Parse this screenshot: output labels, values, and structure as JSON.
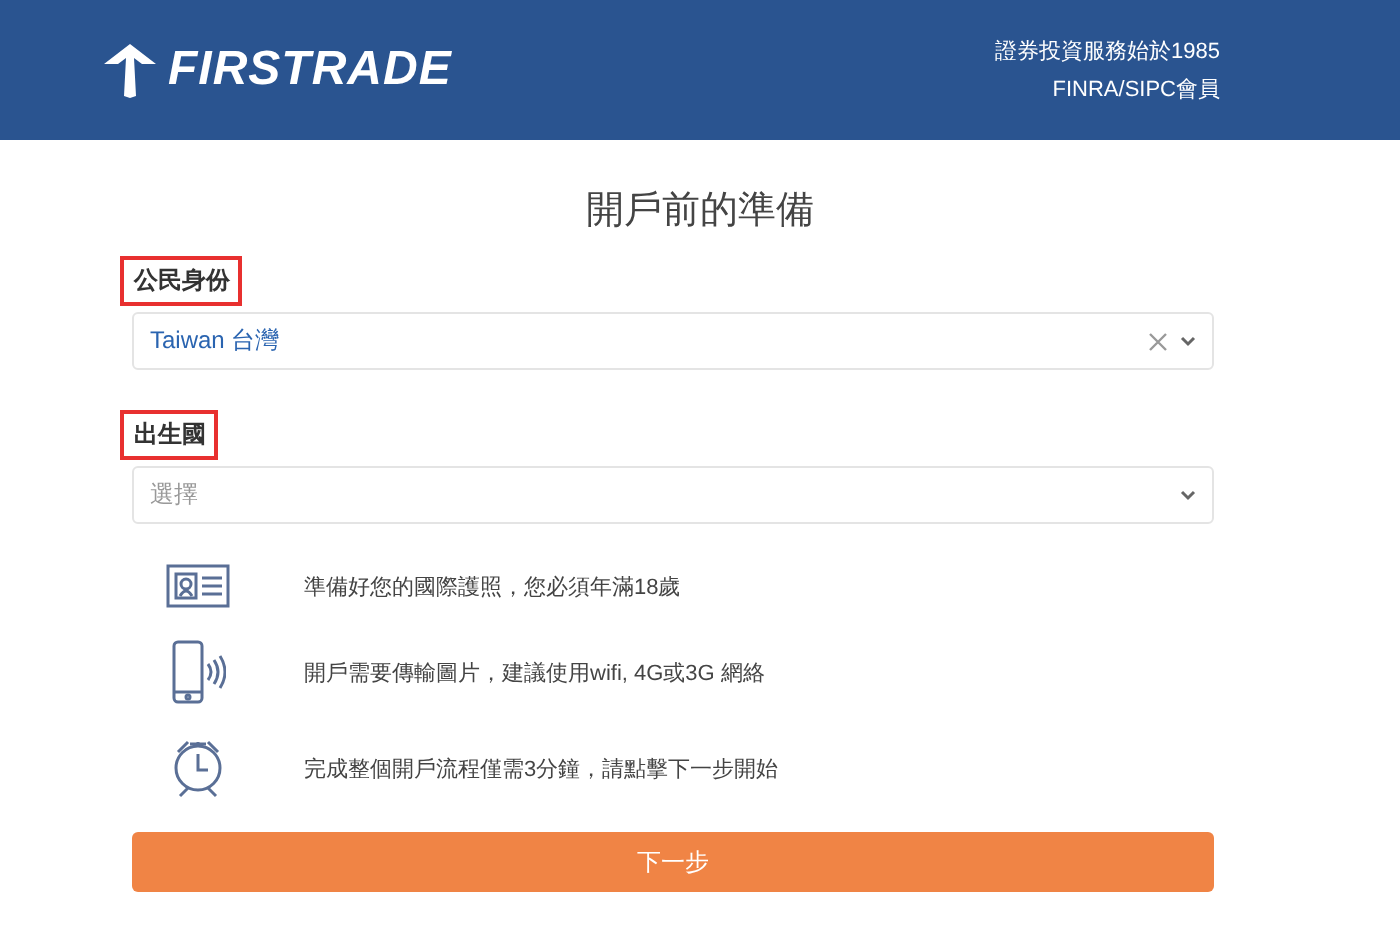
{
  "header": {
    "logo": "FIRSTRADE",
    "tagline": "證券投資服務始於1985",
    "membership": "FINRA/SIPC會員"
  },
  "title": "開戶前的準備",
  "fields": [
    {
      "label": "公民身份",
      "highlighted": true,
      "value": "Taiwan 台灣",
      "clearable": true
    },
    {
      "label": "出生國",
      "highlighted": true,
      "placeholder": "選擇",
      "clearable": false
    }
  ],
  "checklist": [
    {
      "kind": "id",
      "text": "準備好您的國際護照，您必須年滿18歲"
    },
    {
      "kind": "phone",
      "text": "開戶需要傳輸圖片，建議使用wifi, 4G或3G 網絡"
    },
    {
      "kind": "clock",
      "text": "完成整個開戶流程僅需3分鐘，請點擊下一步開始"
    }
  ],
  "next_button": "下一步"
}
